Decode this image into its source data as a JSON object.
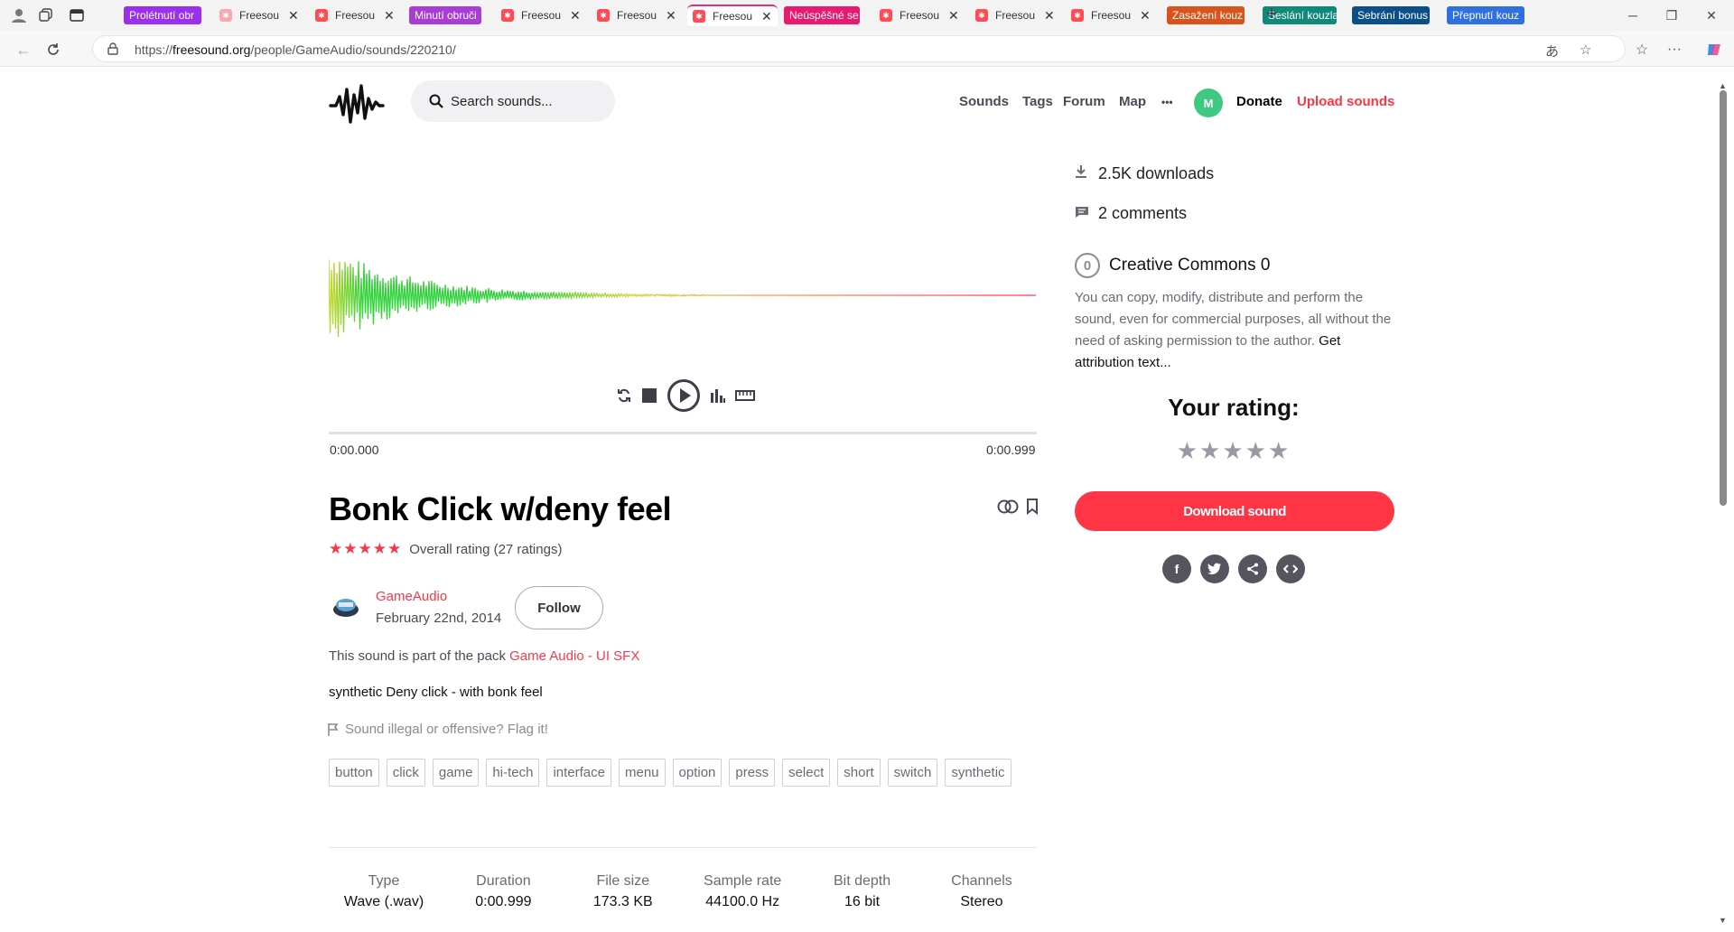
{
  "browser": {
    "tabs": [
      {
        "label": "Prolétnutí obr",
        "type": "group",
        "color": "#9b2ff0"
      },
      {
        "label": "Freesou",
        "type": "site"
      },
      {
        "label": "Freesou",
        "type": "site"
      },
      {
        "label": "Minutí obruči",
        "type": "group",
        "color": "#a93bd6"
      },
      {
        "label": "Freesou",
        "type": "site"
      },
      {
        "label": "Freesou",
        "type": "site"
      },
      {
        "label": "Freesou",
        "type": "site",
        "active": true
      },
      {
        "label": "Neúspěšné se",
        "type": "group",
        "color": "#e8196f"
      },
      {
        "label": "Freesou",
        "type": "site"
      },
      {
        "label": "Freesou",
        "type": "site"
      },
      {
        "label": "Freesou",
        "type": "site"
      },
      {
        "label": "Zasažení kouz",
        "type": "group",
        "color": "#d9541c"
      },
      {
        "label": "Seslání kouzla",
        "type": "group",
        "color": "#0f8a7a"
      },
      {
        "label": "Sebrání bonus",
        "type": "group",
        "color": "#0b4f8a"
      },
      {
        "label": "Přepnutí kouz",
        "type": "group",
        "color": "#2f6fe0"
      }
    ],
    "url": {
      "prefix": "https://",
      "domain": "freesound.org",
      "path": "/people/GameAudio/sounds/220210/"
    }
  },
  "header": {
    "search_placeholder": "Search sounds...",
    "nav": [
      "Sounds",
      "Tags",
      "Forum",
      "Map"
    ],
    "more": "•••",
    "user_initial": "M",
    "donate": "Donate",
    "upload": "Upload sounds"
  },
  "player": {
    "time_start": "0:00.000",
    "time_end": "0:00.999"
  },
  "sound": {
    "title": "Bonk Click w/deny feel",
    "stars": "★★★★★",
    "rating_text": "Overall rating (27 ratings)",
    "username": "GameAudio",
    "date": "February 22nd, 2014",
    "follow": "Follow",
    "pack_prefix": "This sound is part of the pack ",
    "pack_name": "Game Audio - UI SFX",
    "description": "synthetic Deny click - with bonk feel",
    "flag_text": "Sound illegal or offensive? Flag it!",
    "tags": [
      "button",
      "click",
      "game",
      "hi-tech",
      "interface",
      "menu",
      "option",
      "press",
      "select",
      "short",
      "switch",
      "synthetic"
    ],
    "specs": [
      {
        "key": "Type",
        "value": "Wave (.wav)"
      },
      {
        "key": "Duration",
        "value": "0:00.999"
      },
      {
        "key": "File size",
        "value": "173.3 KB"
      },
      {
        "key": "Sample rate",
        "value": "44100.0 Hz"
      },
      {
        "key": "Bit depth",
        "value": "16 bit"
      },
      {
        "key": "Channels",
        "value": "Stereo"
      }
    ]
  },
  "sidebar": {
    "downloads": "2.5K downloads",
    "comments": "2 comments",
    "license_name": "Creative Commons 0",
    "license_icon": "0",
    "license_text": "You can copy, modify, distribute and perform the sound, even for commercial purposes, all without the need of asking permission to the author. ",
    "license_link": "Get attribution text...",
    "your_rating_label": "Your rating:",
    "rating_stars": "★★★★★",
    "download_button": "Download sound",
    "share_icons": [
      "facebook-icon",
      "twitter-icon",
      "share-icon",
      "embed-icon"
    ]
  },
  "colors": {
    "accent": "#ff3546",
    "avatar": "#3ec882"
  }
}
